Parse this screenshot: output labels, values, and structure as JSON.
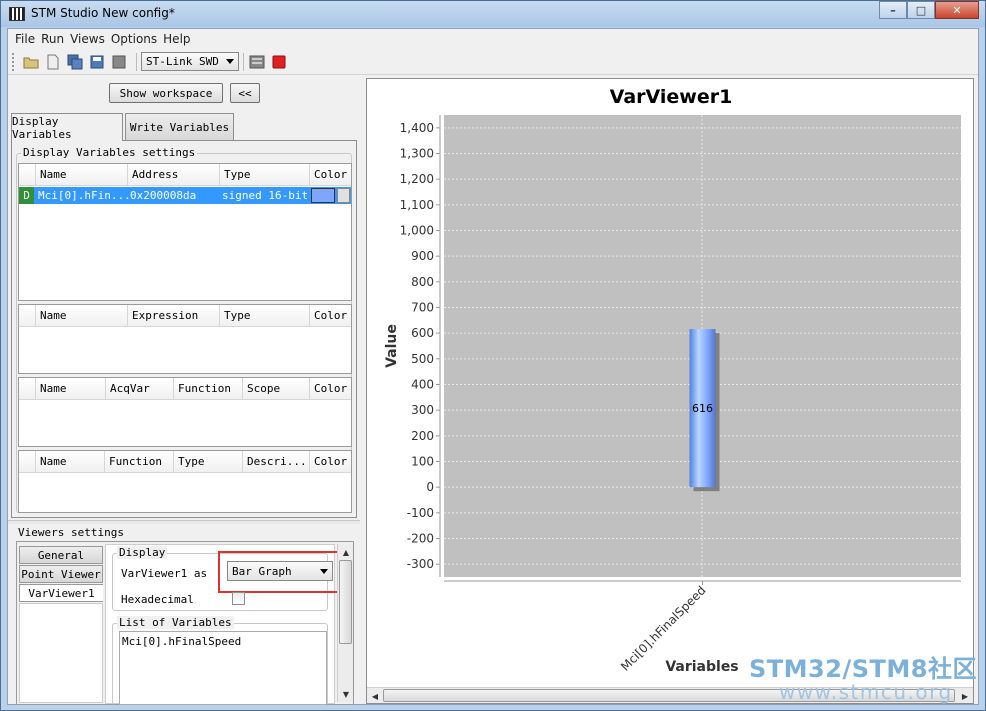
{
  "window": {
    "title": "STM Studio New config*",
    "min": "–",
    "max": "□",
    "close": "✕"
  },
  "menu": {
    "items": [
      "File",
      "Run",
      "Views",
      "Options",
      "Help"
    ]
  },
  "toolbar": {
    "probe_select": "ST-Link SWD"
  },
  "left": {
    "show_workspace": "Show workspace",
    "collapse": "<<",
    "tabs": [
      "Display Variables",
      "Write Variables"
    ],
    "dv_settings_title": "Display Variables settings",
    "table1": {
      "headers": [
        "Name",
        "Address",
        "Type",
        "Color"
      ],
      "row": {
        "badge": "D",
        "name": "Mci[0].hFin...",
        "address": "0x200008da",
        "type": "signed 16-bit"
      }
    },
    "table2": {
      "headers": [
        "Name",
        "Expression",
        "Type",
        "Color"
      ]
    },
    "table3": {
      "headers": [
        "Name",
        "AcqVar",
        "Function",
        "Scope",
        "Color"
      ]
    },
    "table4": {
      "headers": [
        "Name",
        "Function",
        "Type",
        "Descri...",
        "Color"
      ]
    },
    "viewers_title": "Viewers settings",
    "viewer_tabs": [
      "General",
      "Point Viewer",
      "VarViewer1"
    ],
    "display_legend": "Display",
    "viewer_as_label": "VarViewer1 as",
    "viewer_as_value": "Bar Graph",
    "hex_label": "Hexadecimal",
    "list_legend": "List of Variables",
    "list_items": [
      "Mci[0].hFinalSpeed"
    ]
  },
  "accent": {
    "selection": "#3399ff",
    "highlight": "#e03030",
    "series_color": "#7fa6ff"
  },
  "chart_data": {
    "type": "bar",
    "title": "VarViewer1",
    "xlabel": "Variables",
    "ylabel": "Value",
    "categories": [
      "Mci[0].hFinalSpeed"
    ],
    "values": [
      616
    ],
    "data_labels": [
      "616"
    ],
    "yticks": [
      "-300",
      "-200",
      "-100",
      "0",
      "100",
      "200",
      "300",
      "400",
      "500",
      "600",
      "700",
      "800",
      "900",
      "1,000",
      "1,100",
      "1,200",
      "1,300",
      "1,400"
    ],
    "ylim": [
      -350,
      1450
    ],
    "grid": true,
    "plot_background": "#c0c0c0"
  },
  "watermark": {
    "top": "STM32/STM8社区",
    "bottom": "www.stmcu.org"
  }
}
